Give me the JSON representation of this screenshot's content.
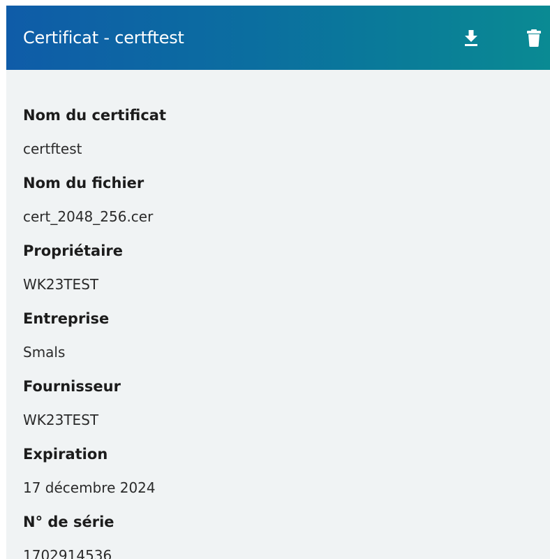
{
  "header": {
    "title": "Certificat - certftest",
    "background_colors": [
      "#0f5ca8",
      "#0a8a93"
    ],
    "download_icon": "download-icon",
    "delete_icon": "trash-icon"
  },
  "fields": [
    {
      "label": "Nom du certificat",
      "value": "certftest"
    },
    {
      "label": "Nom du fichier",
      "value": "cert_2048_256.cer"
    },
    {
      "label": "Propriétaire",
      "value": "WK23TEST"
    },
    {
      "label": "Entreprise",
      "value": "Smals"
    },
    {
      "label": "Fournisseur",
      "value": "WK23TEST"
    },
    {
      "label": "Expiration",
      "value": "17 décembre 2024"
    },
    {
      "label": "N° de série",
      "value": "1702914536"
    }
  ]
}
